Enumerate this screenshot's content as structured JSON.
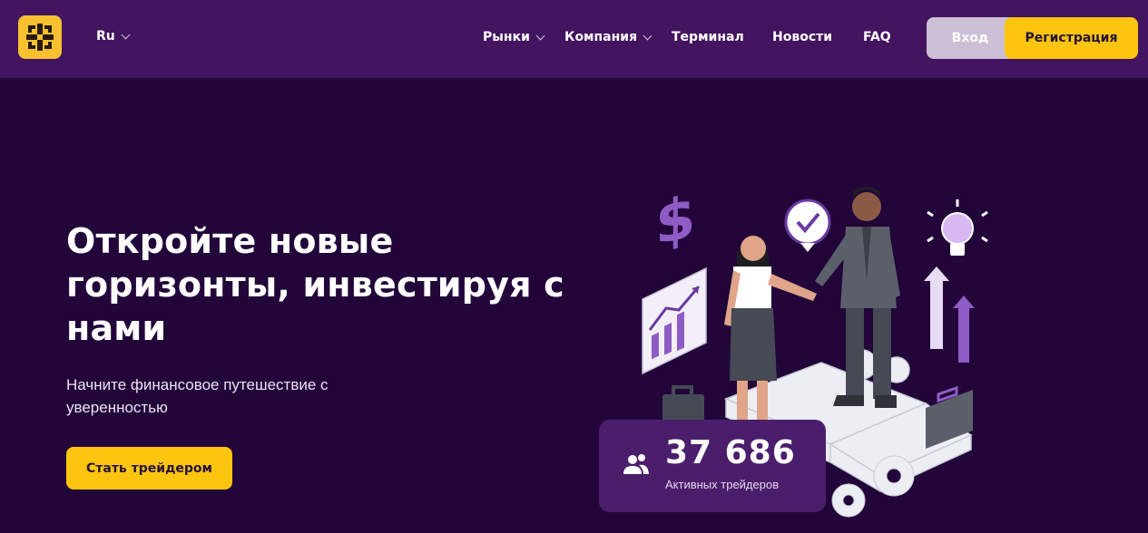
{
  "header": {
    "logo_icon": "brand-logo-icon",
    "language": "Ru",
    "nav": {
      "markets": "Рынки",
      "company": "Компания",
      "terminal": "Терминал",
      "news": "Новости",
      "faq": "FAQ"
    },
    "login_label": "Вход",
    "register_label": "Регистрация"
  },
  "hero": {
    "title": "Откройте новые горизонты, инвестируя с нами",
    "subtitle": "Начните финансовое путешествие с уверенностью",
    "cta_label": "Стать трейдером"
  },
  "stats": {
    "icon": "users-icon",
    "traders_count": "37 686",
    "traders_label": "Активных трейдеров"
  },
  "colors": {
    "background": "#22063a",
    "header": "#431460",
    "accent_yellow": "#fdc410",
    "card": "#4b1e6c",
    "illustration_purple": "#8e5cc4"
  }
}
